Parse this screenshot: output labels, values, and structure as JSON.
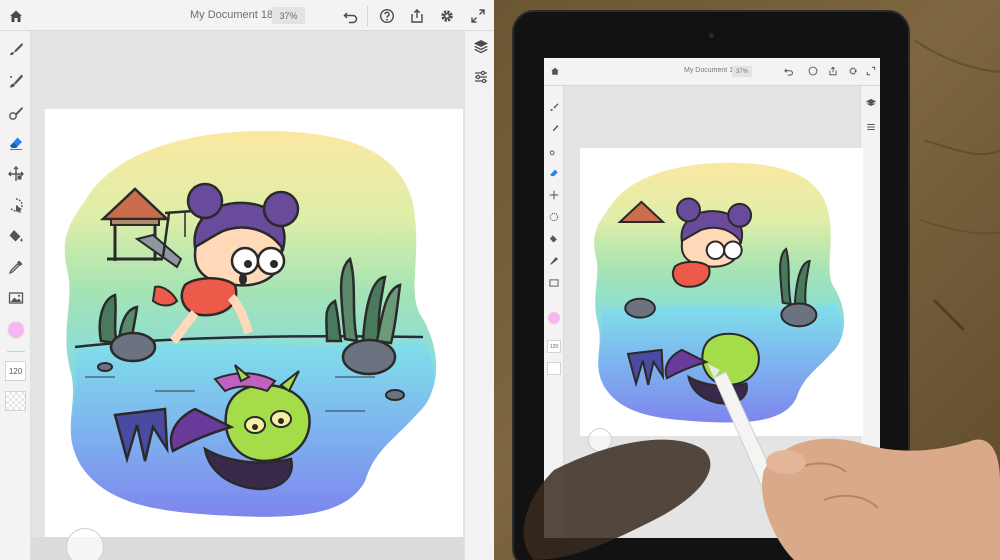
{
  "app": {
    "document_title": "My Document 18",
    "zoom_level": "37%",
    "brush_size": "120",
    "brush_color": "#f6b6f0",
    "accent_color": "#2680eb",
    "topbar_icons": [
      "home-icon",
      "undo-icon",
      "help-icon",
      "share-icon",
      "gear-icon",
      "fullscreen-icon"
    ],
    "tools": [
      "pixel-brush-icon",
      "live-brush-icon",
      "vector-brush-icon",
      "eraser-icon",
      "transform-icon",
      "selection-icon",
      "fill-icon",
      "eyedropper-icon",
      "image-icon"
    ],
    "active_tool": "eraser-icon",
    "right_panel": [
      "layers-icon",
      "layer-properties-icon"
    ]
  },
  "tablet_screen": {
    "document_title": "My Document 18",
    "zoom_level": "37%",
    "brush_size": "120"
  }
}
